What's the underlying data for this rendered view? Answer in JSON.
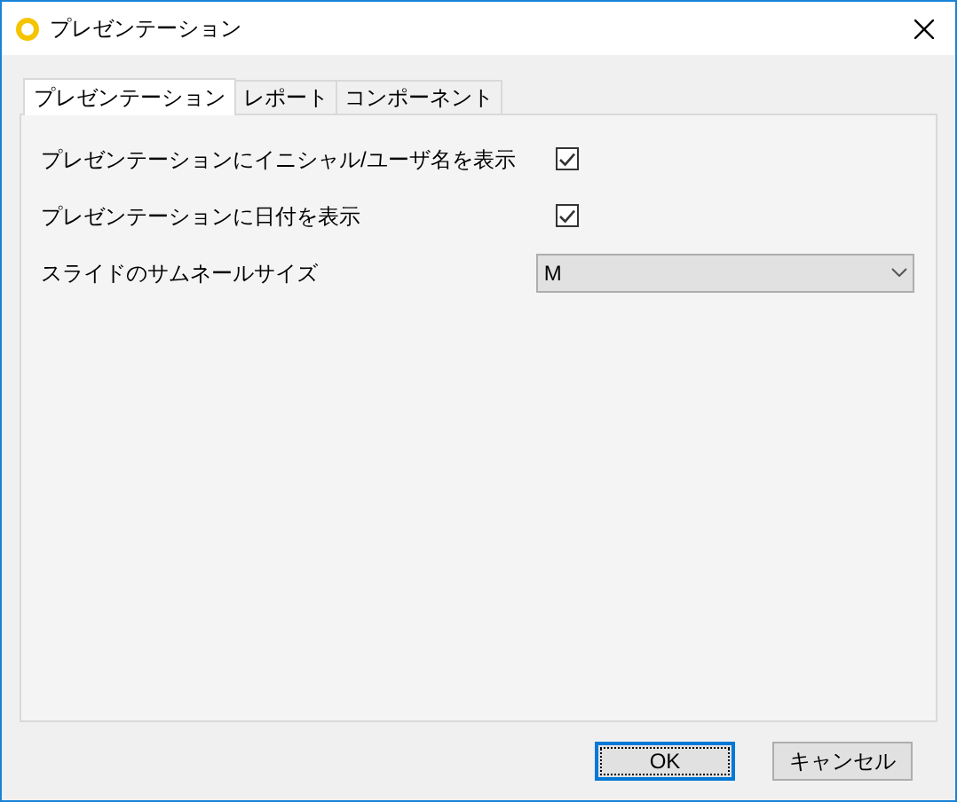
{
  "window": {
    "title": "プレゼンテーション"
  },
  "tabs": [
    {
      "label": "プレゼンテーション",
      "selected": true
    },
    {
      "label": "レポート",
      "selected": false
    },
    {
      "label": "コンポーネント",
      "selected": false
    }
  ],
  "settings": [
    {
      "kind": "checkbox",
      "label": "プレゼンテーションにイニシャル/ユーザ名を表示",
      "checked": true
    },
    {
      "kind": "checkbox",
      "label": "プレゼンテーションに日付を表示",
      "checked": true
    },
    {
      "kind": "dropdown",
      "label": "スライドのサムネールサイズ",
      "value": "M"
    }
  ],
  "buttons": [
    {
      "label": "OK",
      "default": true
    },
    {
      "label": "キャンセル",
      "default": false
    }
  ]
}
